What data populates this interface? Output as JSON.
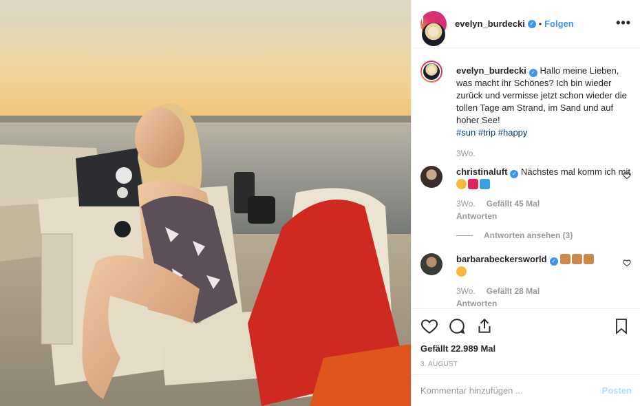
{
  "header": {
    "username": "evelyn_burdecki",
    "verified_glyph": "✓",
    "separator": "•",
    "follow_label": "Folgen",
    "more_label": "•••"
  },
  "caption": {
    "username": "evelyn_burdecki",
    "text": "Hallo meine Lieben, was macht ihr Schönes? Ich bin wieder zurück und vermisse jetzt schon wieder die tollen Tage am Strand, im Sand und auf hoher See!",
    "hashtags": [
      "#sun",
      "#trip",
      "#happy"
    ],
    "time": "3Wo."
  },
  "comments": [
    {
      "username": "christinaluft",
      "text": "Nächstes mal komm ich mit",
      "emojis": [
        "grinning-face-emoji",
        "red-heart-emoji",
        "wave-emoji"
      ],
      "time": "3Wo.",
      "likes": "Gefällt 45 Mal",
      "reply": "Antworten",
      "view_replies": "Antworten ansehen (3)"
    },
    {
      "username": "barbarabeckersworld",
      "text": "",
      "emojis": [
        "folded-hands-emoji",
        "folded-hands-emoji",
        "folded-hands-emoji",
        "heart-eyes-emoji"
      ],
      "time": "3Wo.",
      "likes": "Gefällt 28 Mal",
      "reply": "Antworten"
    }
  ],
  "actions": {
    "likes": "Gefällt 22.989 Mal",
    "date": "3. AUGUST"
  },
  "composer": {
    "placeholder": "Kommentar hinzufügen ...",
    "post_label": "Posten"
  },
  "colors": {
    "accent": "#3897f0",
    "post_disabled": "#b3dbff",
    "muted": "#999999"
  }
}
